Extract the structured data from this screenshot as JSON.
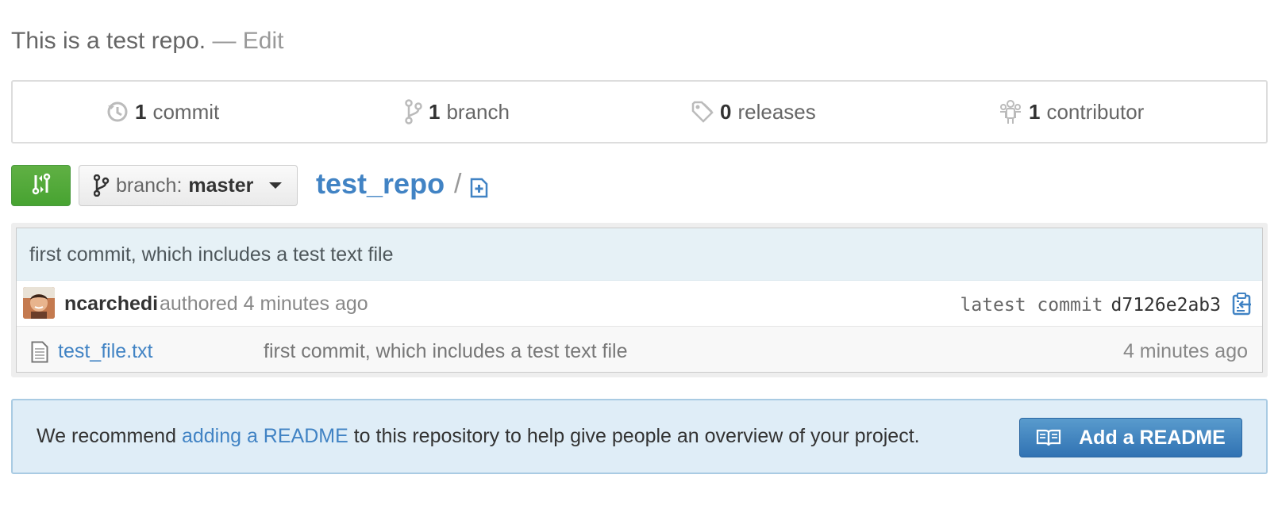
{
  "repo_description": {
    "text": "This is a test repo.",
    "edit_label": "— Edit"
  },
  "summary": {
    "commits": {
      "count": "1",
      "label": "commit",
      "icon": "history-icon"
    },
    "branches": {
      "count": "1",
      "label": "branch",
      "icon": "branch-icon"
    },
    "releases": {
      "count": "0",
      "label": "releases",
      "icon": "tag-icon"
    },
    "contributors": {
      "count": "1",
      "label": "contributor",
      "icon": "organization-icon"
    }
  },
  "toolbar": {
    "compare_icon": "compare-icon",
    "branch_prefix": "branch:",
    "branch_name": "master",
    "repo_name": "test_repo",
    "path_separator": "/",
    "new_file_icon": "new-file-icon"
  },
  "latest_commit": {
    "message": "first commit, which includes a test text file",
    "author": "ncarchedi",
    "authored_text": "authored 4 minutes ago",
    "latest_label": "latest commit",
    "sha": "d7126e2ab3",
    "copy_icon": "clipboard-icon"
  },
  "files": [
    {
      "name": "test_file.txt",
      "message": "first commit, which includes a test text file",
      "age": "4 minutes ago",
      "icon": "file-text-icon"
    }
  ],
  "readme_prompt": {
    "text_before": "We recommend ",
    "link_text": "adding a README",
    "text_after": " to this repository to help give people an overview of your project.",
    "button_label": "Add a README",
    "button_icon": "book-icon"
  },
  "colors": {
    "link": "#4183c4",
    "compare_green": "#47a331",
    "readme_button_blue": "#3072b3",
    "readme_bg": "#dfedf7"
  }
}
